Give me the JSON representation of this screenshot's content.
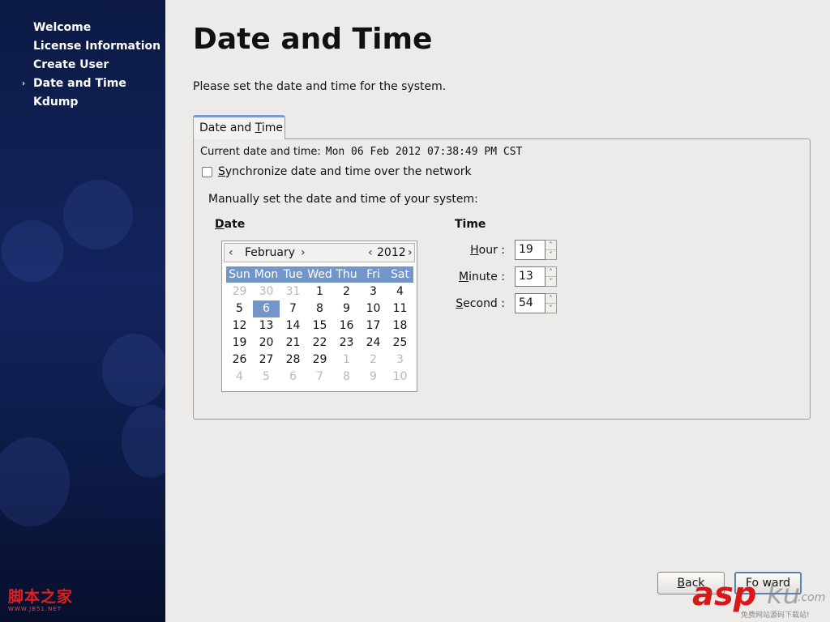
{
  "sidebar": {
    "items": [
      {
        "label": "Welcome",
        "current": false
      },
      {
        "label": "License Information",
        "current": false
      },
      {
        "label": "Create User",
        "current": false
      },
      {
        "label": "Date and Time",
        "current": true
      },
      {
        "label": "Kdump",
        "current": false
      }
    ],
    "current_marker": "›",
    "watermark_cn": "脚本之家",
    "watermark_url": "WWW.JB51.NET"
  },
  "page": {
    "title": "Date and Time",
    "intro": "Please set the date and time for the system."
  },
  "tab": {
    "label_pre": "Date and ",
    "label_accel": "T",
    "label_post": "ime"
  },
  "current": {
    "label": "Current date and time:",
    "value": "Mon 06 Feb 2012 07:38:49 PM CST"
  },
  "sync": {
    "checked": false,
    "label_accel": "S",
    "label_rest": "ynchronize date and time over the network"
  },
  "manual_label": "Manually set the date and time of your system:",
  "date_section": {
    "accel": "D",
    "rest": "ate"
  },
  "time_section": {
    "label": "Time"
  },
  "calendar": {
    "month": "February",
    "year": "2012",
    "prev": "‹",
    "next": "›",
    "weekdays": [
      "Sun",
      "Mon",
      "Tue",
      "Wed",
      "Thu",
      "Fri",
      "Sat"
    ],
    "selected": "6",
    "weeks": [
      [
        {
          "d": "29",
          "o": true
        },
        {
          "d": "30",
          "o": true
        },
        {
          "d": "31",
          "o": true
        },
        {
          "d": "1"
        },
        {
          "d": "2"
        },
        {
          "d": "3"
        },
        {
          "d": "4"
        }
      ],
      [
        {
          "d": "5"
        },
        {
          "d": "6",
          "s": true
        },
        {
          "d": "7"
        },
        {
          "d": "8"
        },
        {
          "d": "9"
        },
        {
          "d": "10"
        },
        {
          "d": "11"
        }
      ],
      [
        {
          "d": "12"
        },
        {
          "d": "13"
        },
        {
          "d": "14"
        },
        {
          "d": "15"
        },
        {
          "d": "16"
        },
        {
          "d": "17"
        },
        {
          "d": "18"
        }
      ],
      [
        {
          "d": "19"
        },
        {
          "d": "20"
        },
        {
          "d": "21"
        },
        {
          "d": "22"
        },
        {
          "d": "23"
        },
        {
          "d": "24"
        },
        {
          "d": "25"
        }
      ],
      [
        {
          "d": "26"
        },
        {
          "d": "27"
        },
        {
          "d": "28"
        },
        {
          "d": "29"
        },
        {
          "d": "1",
          "o": true
        },
        {
          "d": "2",
          "o": true
        },
        {
          "d": "3",
          "o": true
        }
      ],
      [
        {
          "d": "4",
          "o": true
        },
        {
          "d": "5",
          "o": true
        },
        {
          "d": "6",
          "o": true
        },
        {
          "d": "7",
          "o": true
        },
        {
          "d": "8",
          "o": true
        },
        {
          "d": "9",
          "o": true
        },
        {
          "d": "10",
          "o": true
        }
      ]
    ]
  },
  "time": {
    "hour": {
      "accel": "H",
      "rest": "our :",
      "value": "19"
    },
    "minute": {
      "accel": "M",
      "rest": "inute :",
      "value": "13"
    },
    "second": {
      "accel": "S",
      "rest": "econd :",
      "value": "54"
    },
    "up": "˄",
    "down": "˅"
  },
  "buttons": {
    "back": {
      "accel": "B",
      "rest": "ack"
    },
    "forward": {
      "text": "Fo ward"
    }
  },
  "watermark": {
    "asp": "asp",
    "ku": "ku",
    "com": ".com",
    "sub": "免费网站源码下载站!"
  },
  "colors": {
    "sidebar": "#13245e",
    "selection": "#7296c9",
    "tab_accent": "#7a9cd0",
    "watermark_red": "#d81818"
  }
}
